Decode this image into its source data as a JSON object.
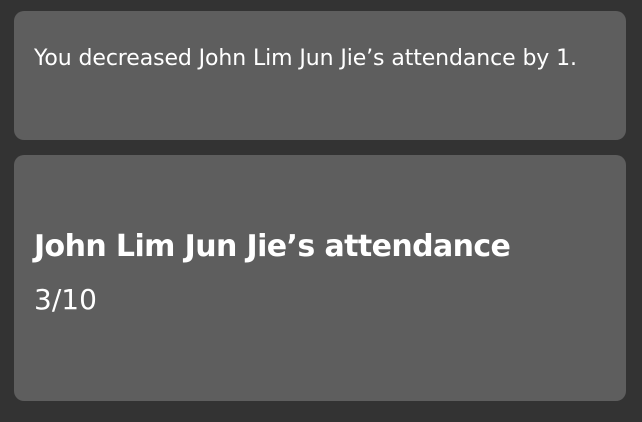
{
  "toast": {
    "message": "You decreased John Lim Jun Jie’s attendance by 1."
  },
  "attendance_card": {
    "title": "John Lim Jun Jie’s attendance",
    "value": "3/10"
  },
  "colors": {
    "background": "#333333",
    "card": "#5e5e5e",
    "text": "#ffffff"
  }
}
